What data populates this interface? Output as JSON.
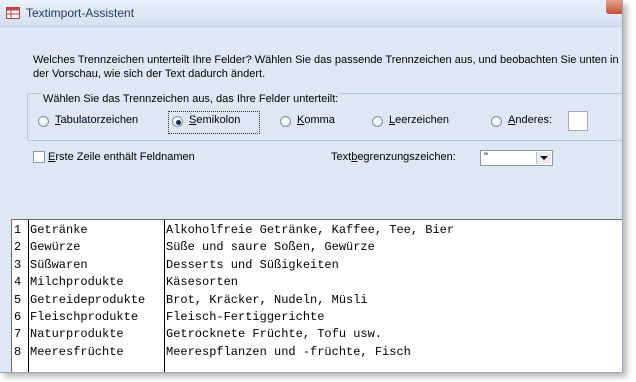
{
  "window": {
    "title": "Textimport-Assistent"
  },
  "instructions": "Welches Trennzeichen unterteilt Ihre Felder? Wählen Sie das passende Trennzeichen aus, und beobachten Sie unten in der Vorschau, wie sich der Text dadurch ändert.",
  "delimiter_group": {
    "title": "Wählen Sie das Trennzeichen aus, das Ihre Felder unterteilt:",
    "options": [
      {
        "pre": "",
        "accel": "T",
        "post": "abulatorzeichen",
        "selected": false
      },
      {
        "pre": "",
        "accel": "S",
        "post": "emikolon",
        "selected": true
      },
      {
        "pre": "",
        "accel": "K",
        "post": "omma",
        "selected": false
      },
      {
        "pre": "",
        "accel": "L",
        "post": "eerzeichen",
        "selected": false
      },
      {
        "pre": "",
        "accel": "A",
        "post": "nderes:",
        "selected": false
      }
    ],
    "other_value": ""
  },
  "first_row": {
    "accel": "E",
    "post": "rste Zeile enthält Feldnamen",
    "checked": false
  },
  "text_qualifier": {
    "pre": "Text",
    "accel": "b",
    "post": "egrenzungszeichen:",
    "value": "\""
  },
  "preview": {
    "rows": [
      {
        "num": "1",
        "category": "Getränke",
        "description": "Alkoholfreie Getränke, Kaffee, Tee, Bier"
      },
      {
        "num": "2",
        "category": "Gewürze",
        "description": "Süße und saure Soßen, Gewürze"
      },
      {
        "num": "3",
        "category": "Süßwaren",
        "description": "Desserts und Süßigkeiten"
      },
      {
        "num": "4",
        "category": "Milchprodukte",
        "description": "Käsesorten"
      },
      {
        "num": "5",
        "category": "Getreideprodukte",
        "description": "Brot, Kräcker, Nudeln, Müsli"
      },
      {
        "num": "6",
        "category": "Fleischprodukte",
        "description": "Fleisch-Fertiggerichte"
      },
      {
        "num": "7",
        "category": "Naturprodukte",
        "description": "Getrocknete Früchte, Tofu usw."
      },
      {
        "num": "8",
        "category": "Meeresfrüchte",
        "description": "Meerespflanzen und -früchte, Fisch"
      }
    ]
  }
}
